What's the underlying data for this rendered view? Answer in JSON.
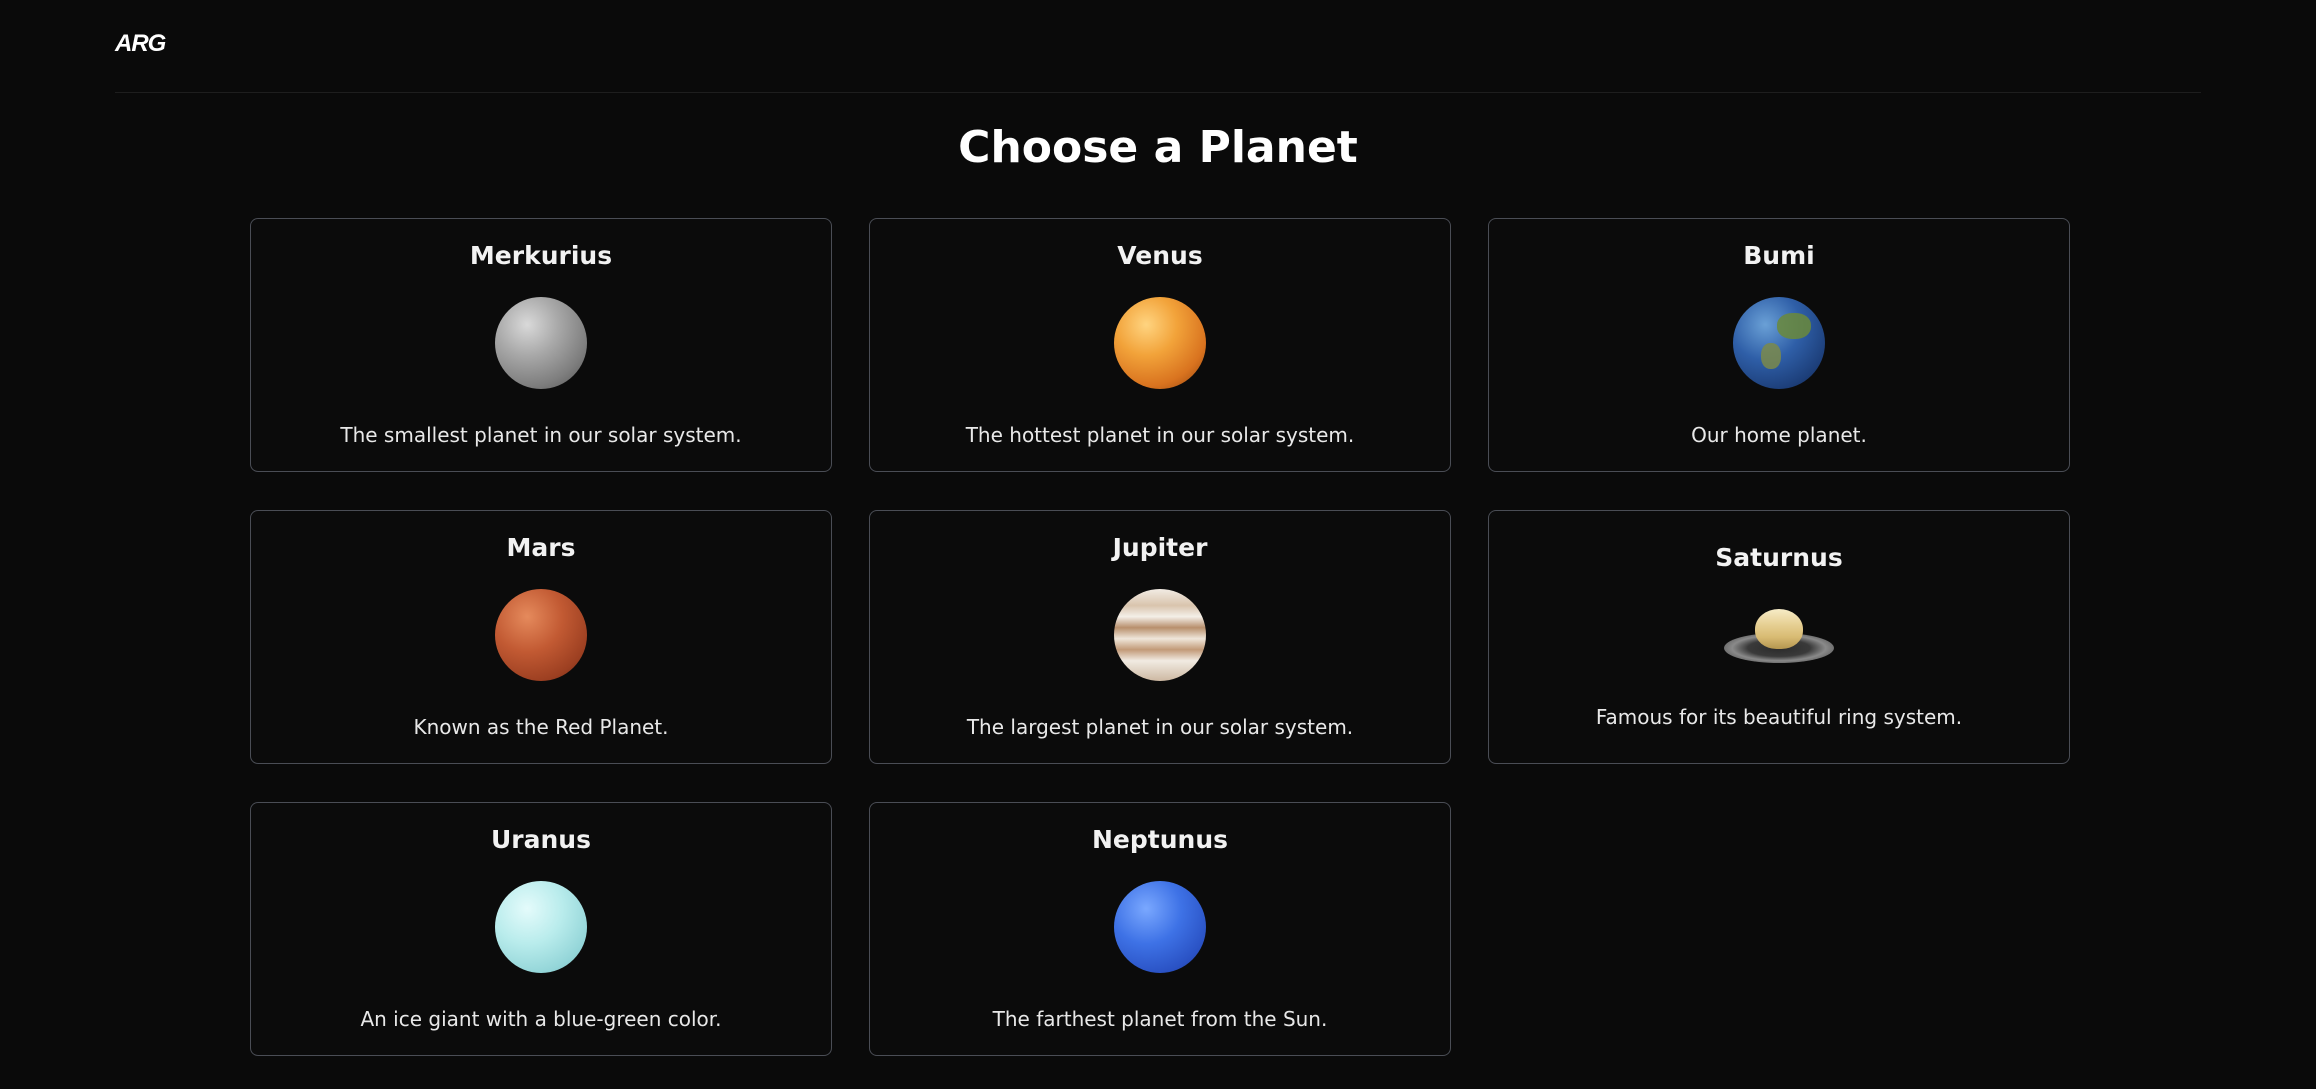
{
  "header": {
    "logo_text": "ARG"
  },
  "page_title": "Choose a Planet",
  "planets": [
    {
      "name": "Merkurius",
      "description": "The smallest planet in our solar system.",
      "icon": "mercury-icon"
    },
    {
      "name": "Venus",
      "description": "The hottest planet in our solar system.",
      "icon": "venus-icon"
    },
    {
      "name": "Bumi",
      "description": "Our home planet.",
      "icon": "earth-icon"
    },
    {
      "name": "Mars",
      "description": "Known as the Red Planet.",
      "icon": "mars-icon"
    },
    {
      "name": "Jupiter",
      "description": "The largest planet in our solar system.",
      "icon": "jupiter-icon"
    },
    {
      "name": "Saturnus",
      "description": "Famous for its beautiful ring system.",
      "icon": "saturn-icon"
    },
    {
      "name": "Uranus",
      "description": "An ice giant with a blue-green color.",
      "icon": "uranus-icon"
    },
    {
      "name": "Neptunus",
      "description": "The farthest planet from the Sun.",
      "icon": "neptune-icon"
    }
  ],
  "colors": {
    "background": "#0a0a0a",
    "card_border": "#4a4d55",
    "text": "#ffffff"
  }
}
